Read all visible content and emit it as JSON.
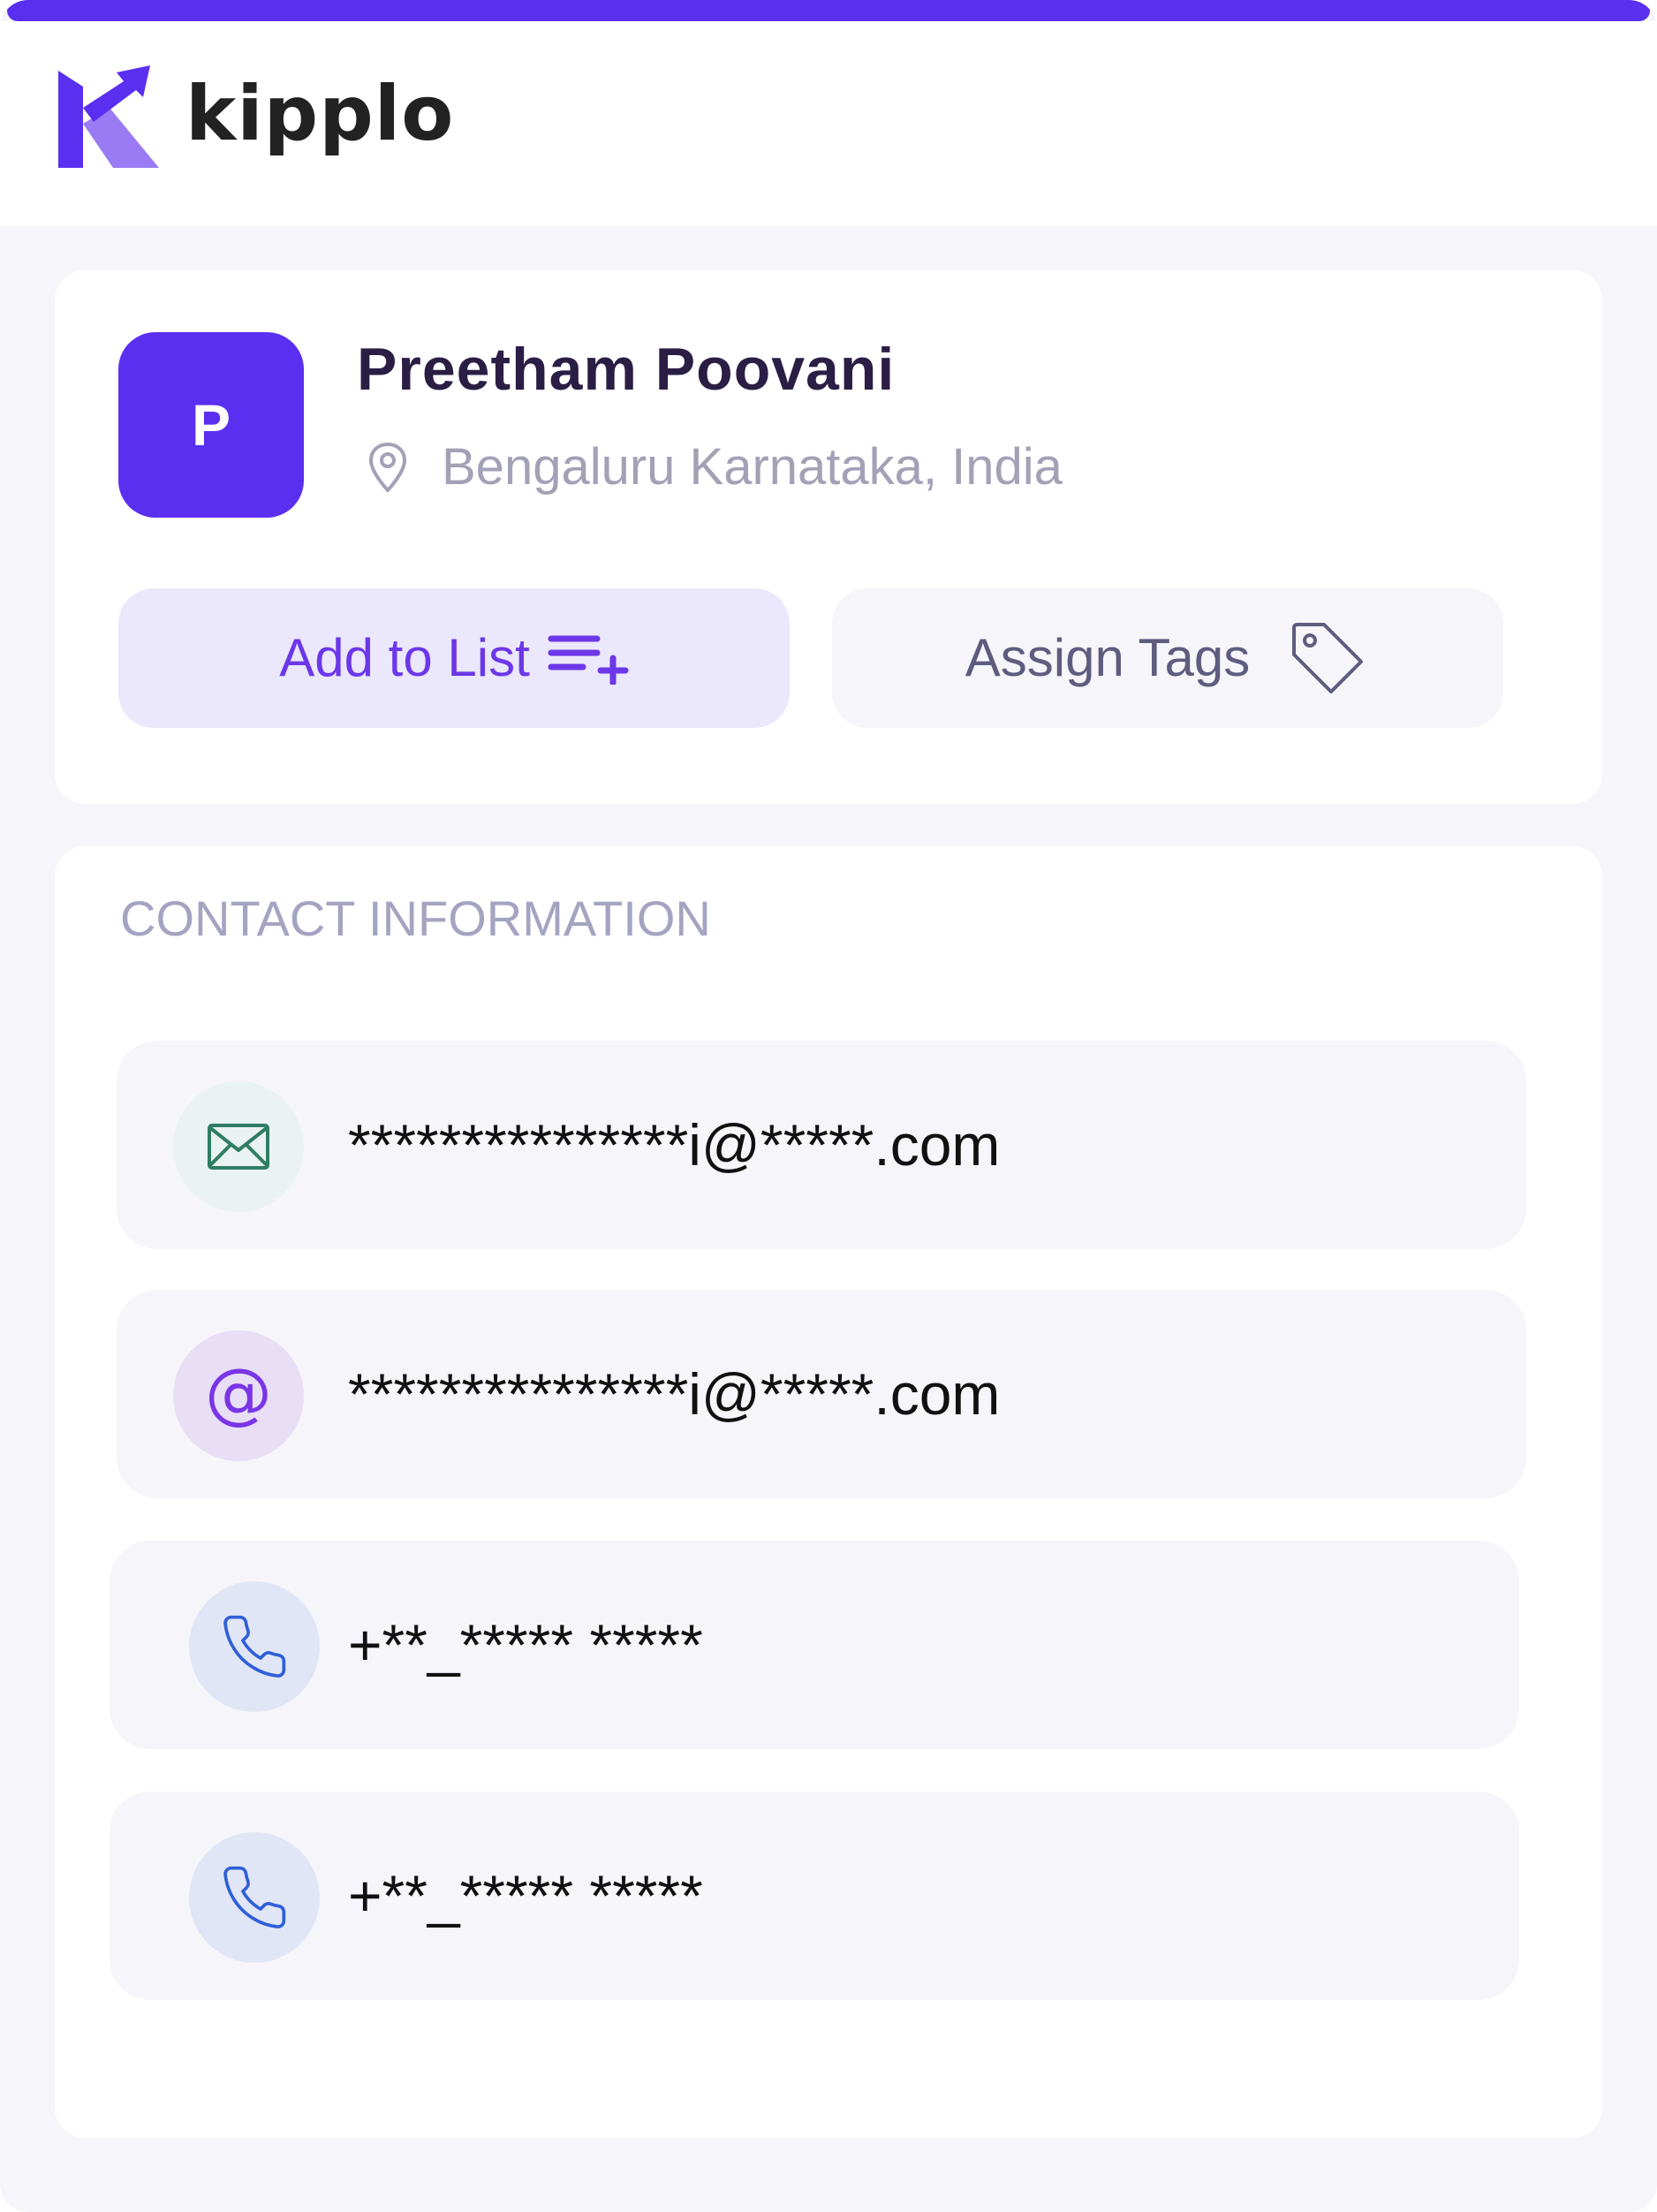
{
  "brand": {
    "name": "kipplo",
    "accent_color": "#5b2ff0"
  },
  "profile": {
    "avatar_initial": "P",
    "name": "Preetham Poovani",
    "location": "Bengaluru Karnataka, India",
    "location_icon": "map-pin-icon"
  },
  "actions": {
    "add_to_list_label": "Add to List",
    "add_to_list_icon": "playlist-add-icon",
    "assign_tags_label": "Assign Tags",
    "assign_tags_icon": "tag-icon"
  },
  "contact": {
    "section_title": "CONTACT INFORMATION",
    "items": [
      {
        "type": "work-email",
        "icon": "envelope-icon",
        "value": "***************i@*****.com"
      },
      {
        "type": "personal-email",
        "icon": "at-sign-icon",
        "value": "***************i@*****.com"
      },
      {
        "type": "phone",
        "icon": "phone-icon",
        "value": "+**_***** *****"
      },
      {
        "type": "phone",
        "icon": "phone-icon",
        "value": "+**_***** *****"
      }
    ]
  }
}
